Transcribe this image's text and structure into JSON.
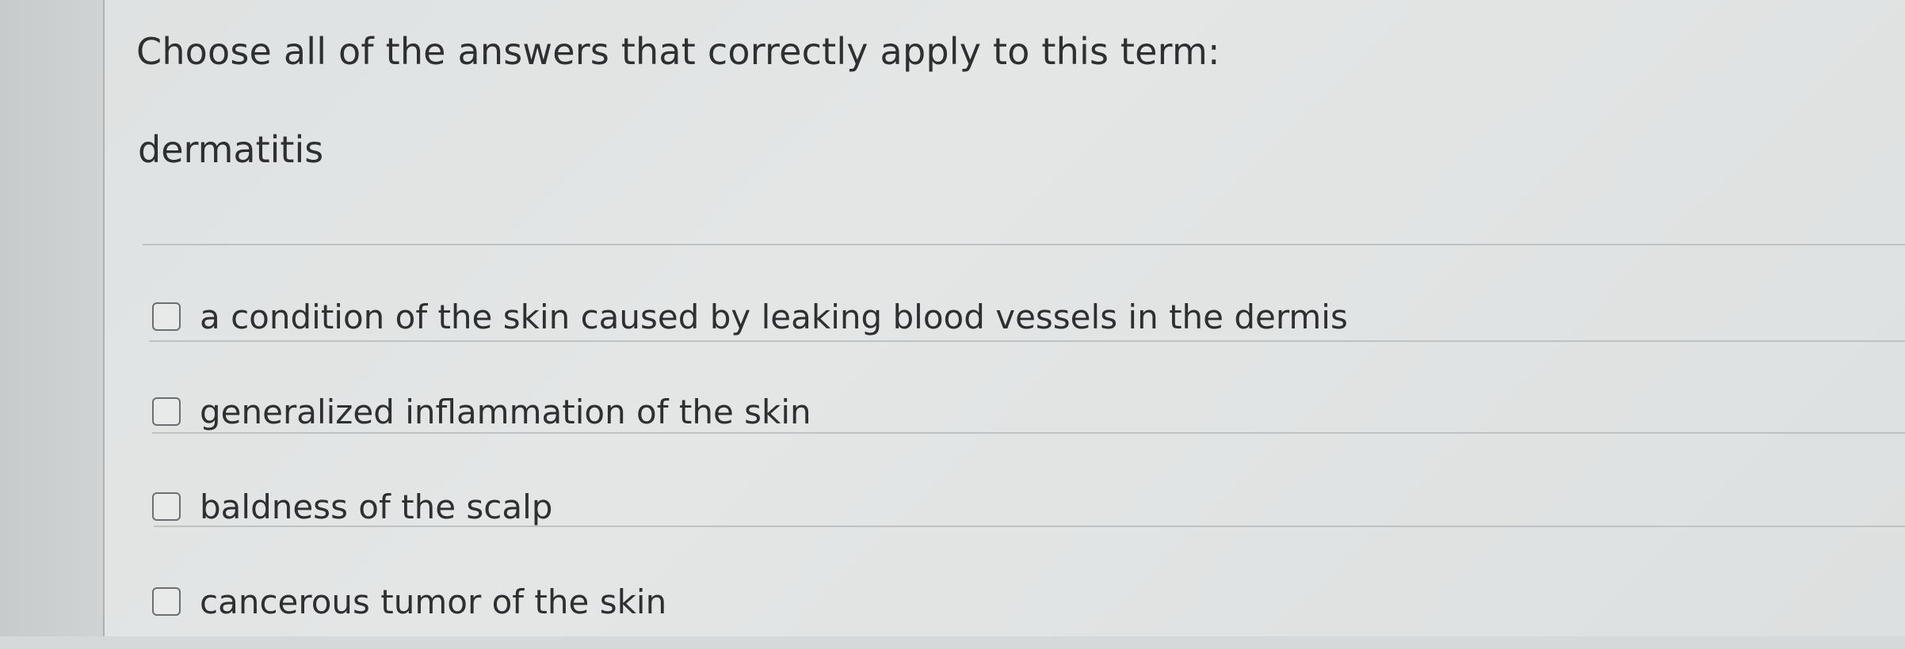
{
  "question": {
    "prompt": "Choose all of the answers that correctly apply to this term:",
    "term": "dermatitis"
  },
  "options": [
    {
      "label": "a condition of the skin caused by leaking blood vessels in the dermis",
      "checked": false
    },
    {
      "label": "generalized inflammation of the skin",
      "checked": false
    },
    {
      "label": "baldness of the scalp",
      "checked": false
    },
    {
      "label": "cancerous tumor of the skin",
      "checked": false
    }
  ]
}
